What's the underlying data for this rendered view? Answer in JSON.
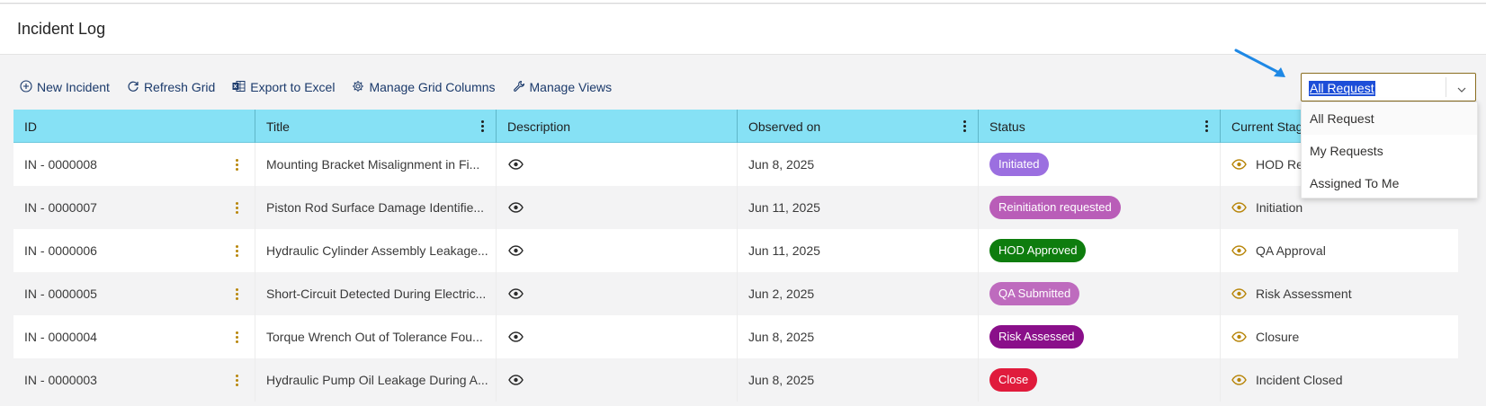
{
  "header": {
    "title": "Incident Log"
  },
  "toolbar": {
    "new_incident": "New Incident",
    "refresh_grid": "Refresh Grid",
    "export_excel": "Export to Excel",
    "manage_columns": "Manage Grid Columns",
    "manage_views": "Manage Views"
  },
  "filter": {
    "selected": "All Request",
    "options": [
      "All Request",
      "My Requests",
      "Assigned To Me"
    ]
  },
  "grid": {
    "columns": [
      "ID",
      "Title",
      "Description",
      "Observed on",
      "Status",
      "Current Stage"
    ],
    "rows": [
      {
        "id": "IN - 0000008",
        "title": "Mounting Bracket Misalignment in Fi...",
        "observed": "Jun 8, 2025",
        "status": "Initiated",
        "status_color": "#9b6fe0",
        "stage": "HOD Re"
      },
      {
        "id": "IN - 0000007",
        "title": "Piston Rod Surface Damage Identifie...",
        "observed": "Jun 11, 2025",
        "status": "Reinitiation requested",
        "status_color": "#b95db8",
        "stage": "Initiation"
      },
      {
        "id": "IN - 0000006",
        "title": "Hydraulic Cylinder Assembly Leakage...",
        "observed": "Jun 11, 2025",
        "status": "HOD Approved",
        "status_color": "#0e7d0e",
        "stage": "QA Approval"
      },
      {
        "id": "IN - 0000005",
        "title": "Short-Circuit Detected During Electric...",
        "observed": "Jun 2, 2025",
        "status": "QA Submitted",
        "status_color": "#be6bbe",
        "stage": "Risk Assessment"
      },
      {
        "id": "IN - 0000004",
        "title": "Torque Wrench Out of Tolerance Fou...",
        "observed": "Jun 8, 2025",
        "status": "Risk Assessed",
        "status_color": "#8a0f8a",
        "stage": "Closure"
      },
      {
        "id": "IN - 0000003",
        "title": "Hydraulic Pump Oil Leakage During A...",
        "observed": "Jun 8, 2025",
        "status": "Close",
        "status_color": "#e01b3c",
        "stage": "Incident Closed"
      }
    ]
  },
  "colors": {
    "header_bg": "#86e1f5",
    "accent": "#1b3a6b",
    "arrow": "#1e88e5"
  }
}
